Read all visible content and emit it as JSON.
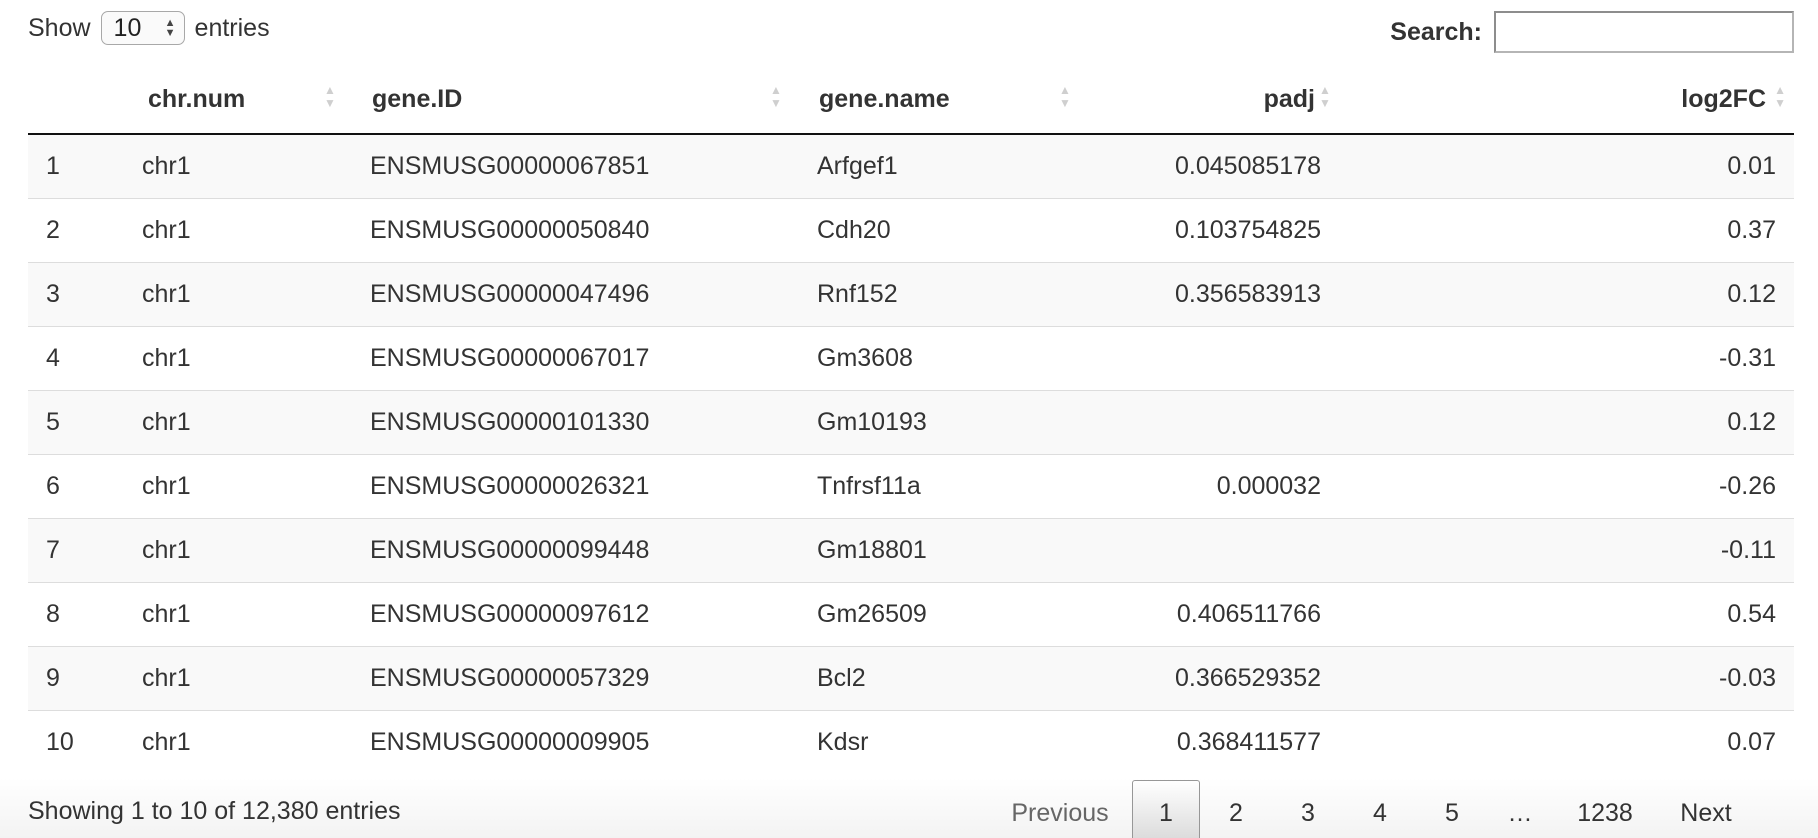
{
  "length_control": {
    "show_label": "Show",
    "selected_value": "10",
    "entries_label": "entries"
  },
  "search": {
    "label": "Search:",
    "value": "",
    "placeholder": ""
  },
  "table": {
    "columns": [
      {
        "key": "idx",
        "label": ""
      },
      {
        "key": "chr",
        "label": "chr.num"
      },
      {
        "key": "gid",
        "label": "gene.ID"
      },
      {
        "key": "gname",
        "label": "gene.name"
      },
      {
        "key": "padj",
        "label": "padj"
      },
      {
        "key": "lfc",
        "label": "log2FC"
      }
    ],
    "rows": [
      [
        "1",
        "chr1",
        "ENSMUSG00000067851",
        "Arfgef1",
        "0.045085178",
        "0.01"
      ],
      [
        "2",
        "chr1",
        "ENSMUSG00000050840",
        "Cdh20",
        "0.103754825",
        "0.37"
      ],
      [
        "3",
        "chr1",
        "ENSMUSG00000047496",
        "Rnf152",
        "0.356583913",
        "0.12"
      ],
      [
        "4",
        "chr1",
        "ENSMUSG00000067017",
        "Gm3608",
        "",
        "-0.31"
      ],
      [
        "5",
        "chr1",
        "ENSMUSG00000101330",
        "Gm10193",
        "",
        "0.12"
      ],
      [
        "6",
        "chr1",
        "ENSMUSG00000026321",
        "Tnfrsf11a",
        "0.000032",
        "-0.26"
      ],
      [
        "7",
        "chr1",
        "ENSMUSG00000099448",
        "Gm18801",
        "",
        "-0.11"
      ],
      [
        "8",
        "chr1",
        "ENSMUSG00000097612",
        "Gm26509",
        "0.406511766",
        "0.54"
      ],
      [
        "9",
        "chr1",
        "ENSMUSG00000057329",
        "Bcl2",
        "0.366529352",
        "-0.03"
      ],
      [
        "10",
        "chr1",
        "ENSMUSG00000009905",
        "Kdsr",
        "0.368411577",
        "0.07"
      ]
    ]
  },
  "footer": {
    "info": "Showing 1 to 10 of 12,380 entries",
    "pagination": {
      "previous": "Previous",
      "pages": [
        "1",
        "2",
        "3",
        "4",
        "5"
      ],
      "ellipsis": "…",
      "last": "1238",
      "next": "Next",
      "current": "1"
    }
  },
  "icons": {
    "sort": "sort-both-icon",
    "select": "select-updown-icon"
  }
}
